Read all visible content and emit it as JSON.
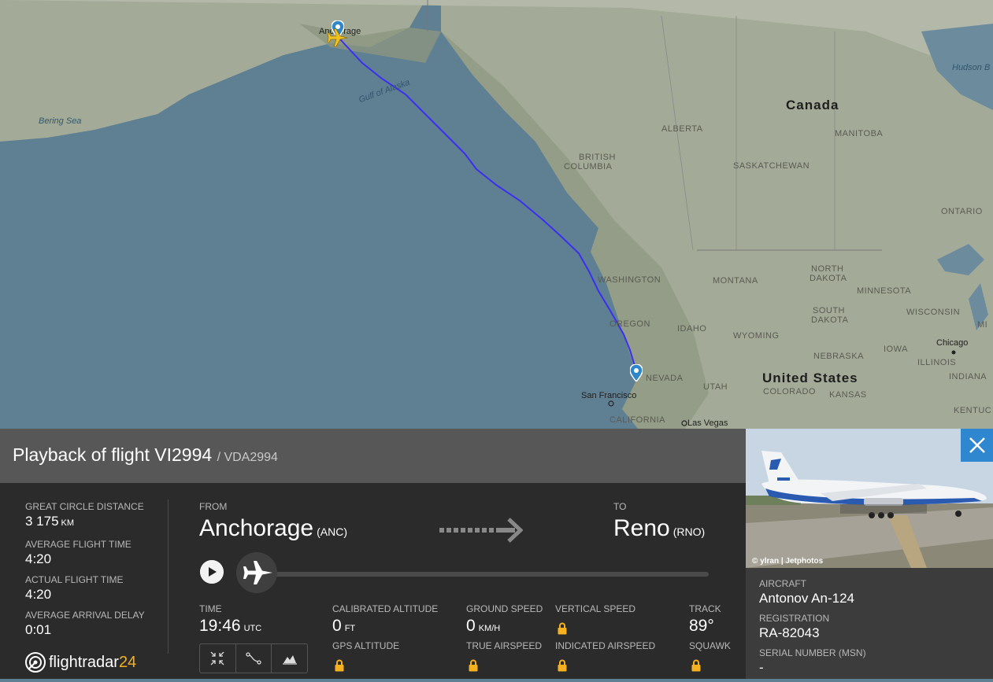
{
  "map": {
    "labels": {
      "bering_sea": "Bering Sea",
      "gulf_of_alaska": "Gulf of Alaska",
      "hudson_bay": "Hudson B",
      "canada": "Canada",
      "united_states": "United States",
      "alberta": "ALBERTA",
      "manitoba": "MANITOBA",
      "british_columbia_1": "BRITISH",
      "british_columbia_2": "COLUMBIA",
      "saskatchewan": "SASKATCHEWAN",
      "ontario": "ONTARIO",
      "washington": "WASHINGTON",
      "montana": "MONTANA",
      "north_dakota_1": "NORTH",
      "north_dakota_2": "DAKOTA",
      "minnesota": "MINNESOTA",
      "south_dakota_1": "SOUTH",
      "south_dakota_2": "DAKOTA",
      "wisconsin": "WISCONSIN",
      "mi": "MI",
      "oregon": "OREGON",
      "idaho": "IDAHO",
      "wyoming": "WYOMING",
      "iowa": "IOWA",
      "chicago": "Chicago",
      "illinois": "ILLINOIS",
      "nebraska": "NEBRASKA",
      "indiana": "INDIANA",
      "nevada": "NEVADA",
      "utah": "UTAH",
      "colorado": "COLORADO",
      "kansas": "KANSAS",
      "san_francisco": "San Francisco",
      "california": "CALIFORNIA",
      "las_vegas": "Las Vegas",
      "kentucky": "KENTUC",
      "anchorage": "Anchorage"
    },
    "colors": {
      "ocean": "#5f7f93",
      "land": "#9ea793",
      "route": "#3c2ff0",
      "pin": "#2f86c9",
      "plane": "#f2c21b"
    }
  },
  "panel": {
    "title": "Playback of flight VI2994",
    "callsign": "/ VDA2994",
    "stats": {
      "great_circle_label": "GREAT CIRCLE DISTANCE",
      "great_circle_value": "3 175",
      "great_circle_unit": "KM",
      "avg_flight_time_label": "AVERAGE FLIGHT TIME",
      "avg_flight_time_value": "4:20",
      "actual_flight_time_label": "ACTUAL FLIGHT TIME",
      "actual_flight_time_value": "4:20",
      "avg_arrival_delay_label": "AVERAGE ARRIVAL DELAY",
      "avg_arrival_delay_value": "0:01"
    },
    "route": {
      "from_label": "FROM",
      "from_city": "Anchorage",
      "from_code": "(ANC)",
      "to_label": "TO",
      "to_city": "Reno",
      "to_code": "(RNO)"
    },
    "playback_progress": 0,
    "data": {
      "time_label": "TIME",
      "time_value": "19:46",
      "time_unit": "UTC",
      "cal_alt_label": "CALIBRATED ALTITUDE",
      "cal_alt_value": "0",
      "cal_alt_unit": "FT",
      "gps_alt_label": "GPS ALTITUDE",
      "ground_speed_label": "GROUND SPEED",
      "ground_speed_value": "0",
      "ground_speed_unit": "KM/H",
      "true_airspeed_label": "TRUE AIRSPEED",
      "vertical_speed_label": "VERTICAL SPEED",
      "indicated_airspeed_label": "INDICATED AIRSPEED",
      "track_label": "TRACK",
      "track_value": "89°",
      "squawk_label": "SQUAWK"
    },
    "logo": {
      "name": "flightradar",
      "accent": "24"
    }
  },
  "aircraft_panel": {
    "photo_credit": "© ylran | Jetphotos",
    "aircraft_label": "AIRCRAFT",
    "aircraft_value": "Antonov An-124",
    "registration_label": "REGISTRATION",
    "registration_value": "RA-82043",
    "serial_label": "SERIAL NUMBER (MSN)",
    "serial_value": "-"
  }
}
